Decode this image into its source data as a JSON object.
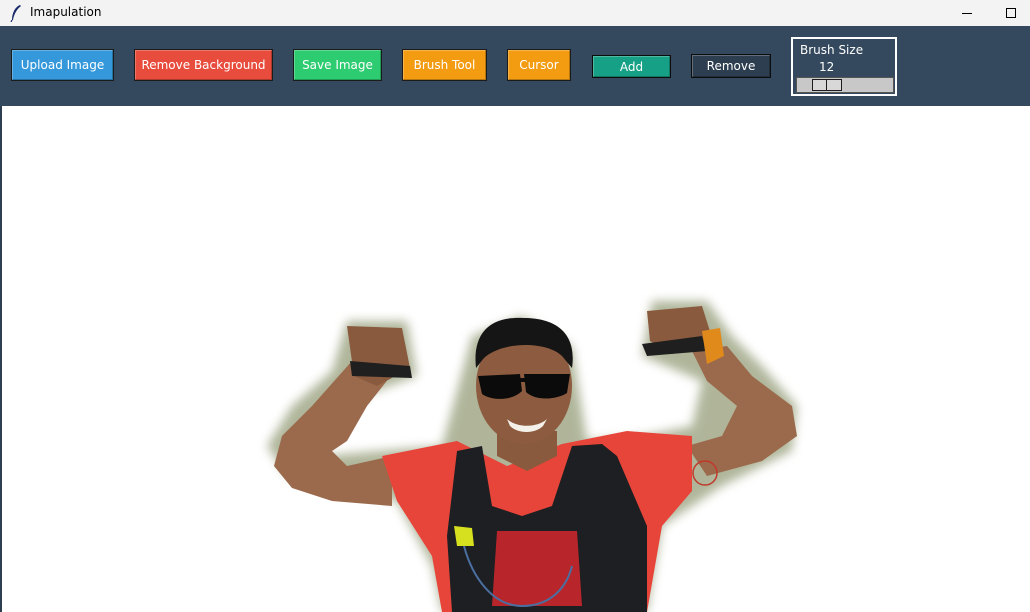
{
  "window": {
    "title": "Imapulation"
  },
  "toolbar": {
    "upload_label": "Upload Image",
    "remove_bg_label": "Remove Background",
    "save_label": "Save Image",
    "brush_label": "Brush Tool",
    "cursor_label": "Cursor",
    "add_label": "Add",
    "remove_label": "Remove",
    "brush_size_title": "Brush Size",
    "brush_size_value": "12"
  },
  "colors": {
    "toolbar_bg": "#34495e",
    "upload": "#3498db",
    "remove_bg": "#e74c3c",
    "save": "#2ecc71",
    "brush": "#f39c12",
    "cursor": "#f39c12",
    "add": "#16a085",
    "remove": "#2c3e50",
    "brush_cursor": "#c0392b"
  },
  "icons": {
    "app": "feather-icon",
    "minimize": "minimize-icon",
    "maximize": "maximize-icon"
  }
}
